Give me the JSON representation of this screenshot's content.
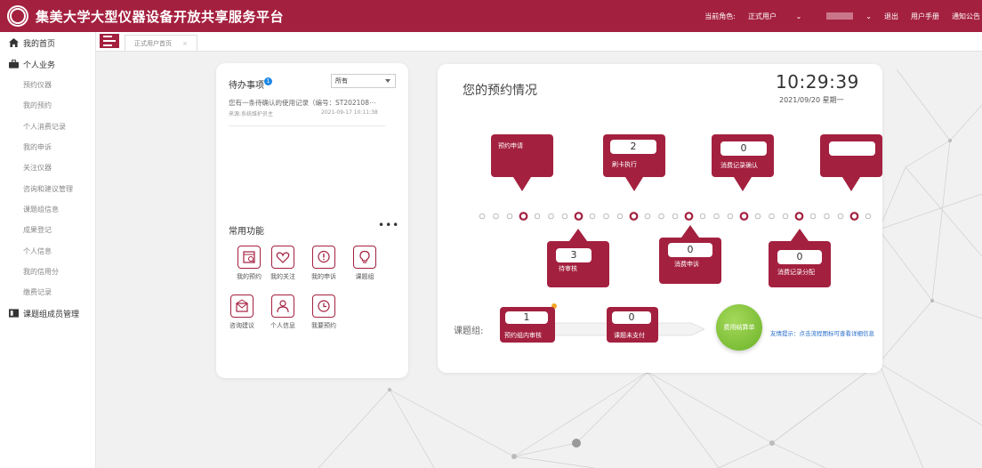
{
  "header": {
    "app_title": "集美大学大型仪器设备开放共享服务平台",
    "role_label": "当前角色:",
    "role_value": "正式用户",
    "logout": "退出",
    "manual": "用户手册",
    "notice": "通知公告"
  },
  "sidebar": {
    "home": "我的首页",
    "personal_section": "个人业务",
    "items": [
      "预约仪器",
      "我的预约",
      "个人消费记录",
      "我的申诉",
      "关注仪器",
      "咨询和建议管理",
      "课题组信息",
      "成果登记",
      "个人信息",
      "我的信用分",
      "缴费记录"
    ],
    "group_section": "课题组成员管理"
  },
  "tabs": {
    "active": "正式用户首页",
    "close": "×"
  },
  "todo": {
    "title": "待办事项",
    "badge": "1",
    "filter": "所有",
    "message": "您有一条待确认的使用记录（编号：ST202108⋯",
    "source": "来源:系统维护员主",
    "time": "2021-09-17 10:11:38"
  },
  "functions": {
    "title": "常用功能",
    "more": "•••",
    "items": [
      {
        "label": "我的预约",
        "icon": "calendar-icon"
      },
      {
        "label": "我的关注",
        "icon": "heart-icon"
      },
      {
        "label": "我的申诉",
        "icon": "alert-bubble-icon"
      },
      {
        "label": "课题组",
        "icon": "lightbulb-icon"
      },
      {
        "label": "咨询建议",
        "icon": "mail-icon"
      },
      {
        "label": "个人信息",
        "icon": "person-icon"
      },
      {
        "label": "我要预约",
        "icon": "clock-icon"
      }
    ]
  },
  "appointments": {
    "title": "您的预约情况",
    "time": "10:29:39",
    "date": "2021/09/20 星期一",
    "top_callouts": [
      {
        "label": "预约申请",
        "value": ""
      },
      {
        "label": "刷卡执行",
        "value": "2"
      },
      {
        "label": "消费记录确认",
        "value": "0"
      },
      {
        "label": "",
        "value": ""
      }
    ],
    "bottom_callouts": [
      {
        "label": "待审核",
        "value": "3"
      },
      {
        "label": "消费申诉",
        "value": "0"
      },
      {
        "label": "消费记录分配",
        "value": "0"
      }
    ]
  },
  "group": {
    "label": "课题组:",
    "steps": [
      {
        "label": "预约组内审核",
        "value": "1"
      },
      {
        "label": "课题未支付",
        "value": "0"
      }
    ],
    "pay_button": "费用结算单",
    "hint": "友情提示：点击流程图标可查看详细信息"
  },
  "colors": {
    "brand": "#a4203f",
    "accent_green": "#7cc02f",
    "link_blue": "#2a6fc9"
  }
}
